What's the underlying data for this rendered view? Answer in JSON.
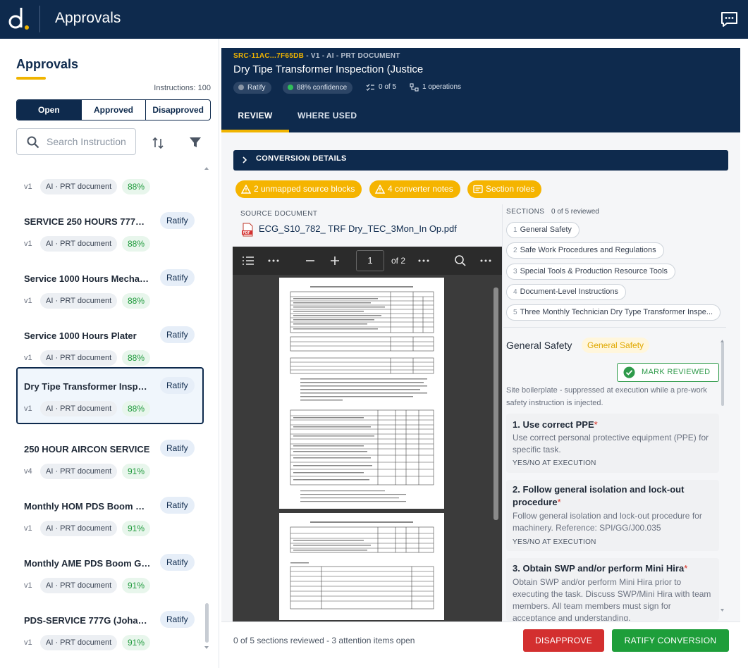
{
  "topbar": {
    "title": "Approvals",
    "logo_text": "d."
  },
  "left": {
    "title": "Approvals",
    "instructions_count": "Instructions: 100",
    "segments": [
      "Open",
      "Approved",
      "Disapproved"
    ],
    "search_placeholder": "Search Instruction",
    "items": [
      {
        "title": "",
        "ratify": "",
        "version": "v1",
        "chip": "AI · PRT document",
        "confidence": "88%"
      },
      {
        "title": "SERVICE 250 HOURS 777G ...",
        "ratify": "Ratify",
        "version": "v1",
        "chip": "AI · PRT document",
        "confidence": "88%"
      },
      {
        "title": "Service 1000 Hours Mechani...",
        "ratify": "Ratify",
        "version": "v1",
        "chip": "AI · PRT document",
        "confidence": "88%"
      },
      {
        "title": "Service 1000 Hours Plater",
        "ratify": "Ratify",
        "version": "v1",
        "chip": "AI · PRT document",
        "confidence": "88%"
      },
      {
        "title": "Dry Tipe Transformer Inspec...",
        "ratify": "Ratify",
        "version": "v1",
        "chip": "AI · PRT document",
        "confidence": "88%"
      },
      {
        "title": "250 HOUR AIRCON SERVICE",
        "ratify": "Ratify",
        "version": "v4",
        "chip": "AI · PRT document",
        "confidence": "91%"
      },
      {
        "title": "Monthly HOM PDS Boom Ga...",
        "ratify": "Ratify",
        "version": "v1",
        "chip": "AI · PRT document",
        "confidence": "91%"
      },
      {
        "title": "Monthly AME PDS Boom Ga...",
        "ratify": "Ratify",
        "version": "v1",
        "chip": "AI · PRT document",
        "confidence": "91%"
      },
      {
        "title": "PDS-SERVICE 777G (Johan...",
        "ratify": "Ratify",
        "version": "v1",
        "chip": "AI · PRT document",
        "confidence": "91%"
      }
    ]
  },
  "header": {
    "id": "SRC-11AC...7F65DB",
    "meta": " - V1 - AI - PRT DOCUMENT",
    "title": "Dry Tipe Transformer Inspection (Justice",
    "ratify_chip": "Ratify",
    "confidence_chip": "88% confidence",
    "progress": "0 of 5",
    "operations": "1 operations",
    "tabs": [
      "REVIEW",
      "WHERE USED"
    ]
  },
  "conversion": {
    "label": "CONVERSION DETAILS"
  },
  "warnings": [
    "2 unmapped source blocks",
    "4 converter notes",
    "Section roles"
  ],
  "source": {
    "label": "SOURCE DOCUMENT",
    "file": "ECG_S10_782_ TRF Dry_TEC_3Mon_In Op.pdf",
    "page": "1",
    "page_of": "of 2"
  },
  "sections": {
    "label": "SECTIONS",
    "count": "0 of 5 reviewed",
    "items": [
      {
        "n": "1",
        "label": "General Safety"
      },
      {
        "n": "2",
        "label": "Safe Work Procedures and Regulations"
      },
      {
        "n": "3",
        "label": "Special Tools & Production Resource Tools"
      },
      {
        "n": "4",
        "label": "Document-Level Instructions"
      },
      {
        "n": "5",
        "label": "Three Monthly Technician Dry Type Transformer Inspe..."
      }
    ]
  },
  "detail": {
    "title": "General Safety",
    "chip": "General Safety",
    "mark_reviewed": "MARK REVIEWED",
    "boilerplate": "Site boilerplate - suppressed at execution while a pre-work safety instruction is injected.",
    "cards": [
      {
        "title": "1. Use correct PPE",
        "desc": "Use correct personal protective equipment (PPE) for specific task.",
        "footer": "YES/NO AT EXECUTION"
      },
      {
        "title": "2. Follow general isolation and lock-out procedure",
        "desc": "Follow general isolation and lock-out procedure for machinery. Reference: SPI/GG/J00.035",
        "footer": "YES/NO AT EXECUTION"
      },
      {
        "title": "3. Obtain SWP and/or perform Mini Hira",
        "desc": "Obtain SWP and/or perform Mini Hira prior to executing the task. Discuss SWP/Mini Hira with team members. All team members must sign for acceptance and understanding.",
        "footer": ""
      }
    ]
  },
  "footer": {
    "status": "0 of 5 sections reviewed - 3 attention items open",
    "disapprove": "DISAPPROVE",
    "ratify": "RATIFY CONVERSION"
  },
  "colors": {
    "navy": "#0e2a4d",
    "accent": "#f0b400",
    "success": "#1e9e3a",
    "danger": "#d32f2f"
  }
}
